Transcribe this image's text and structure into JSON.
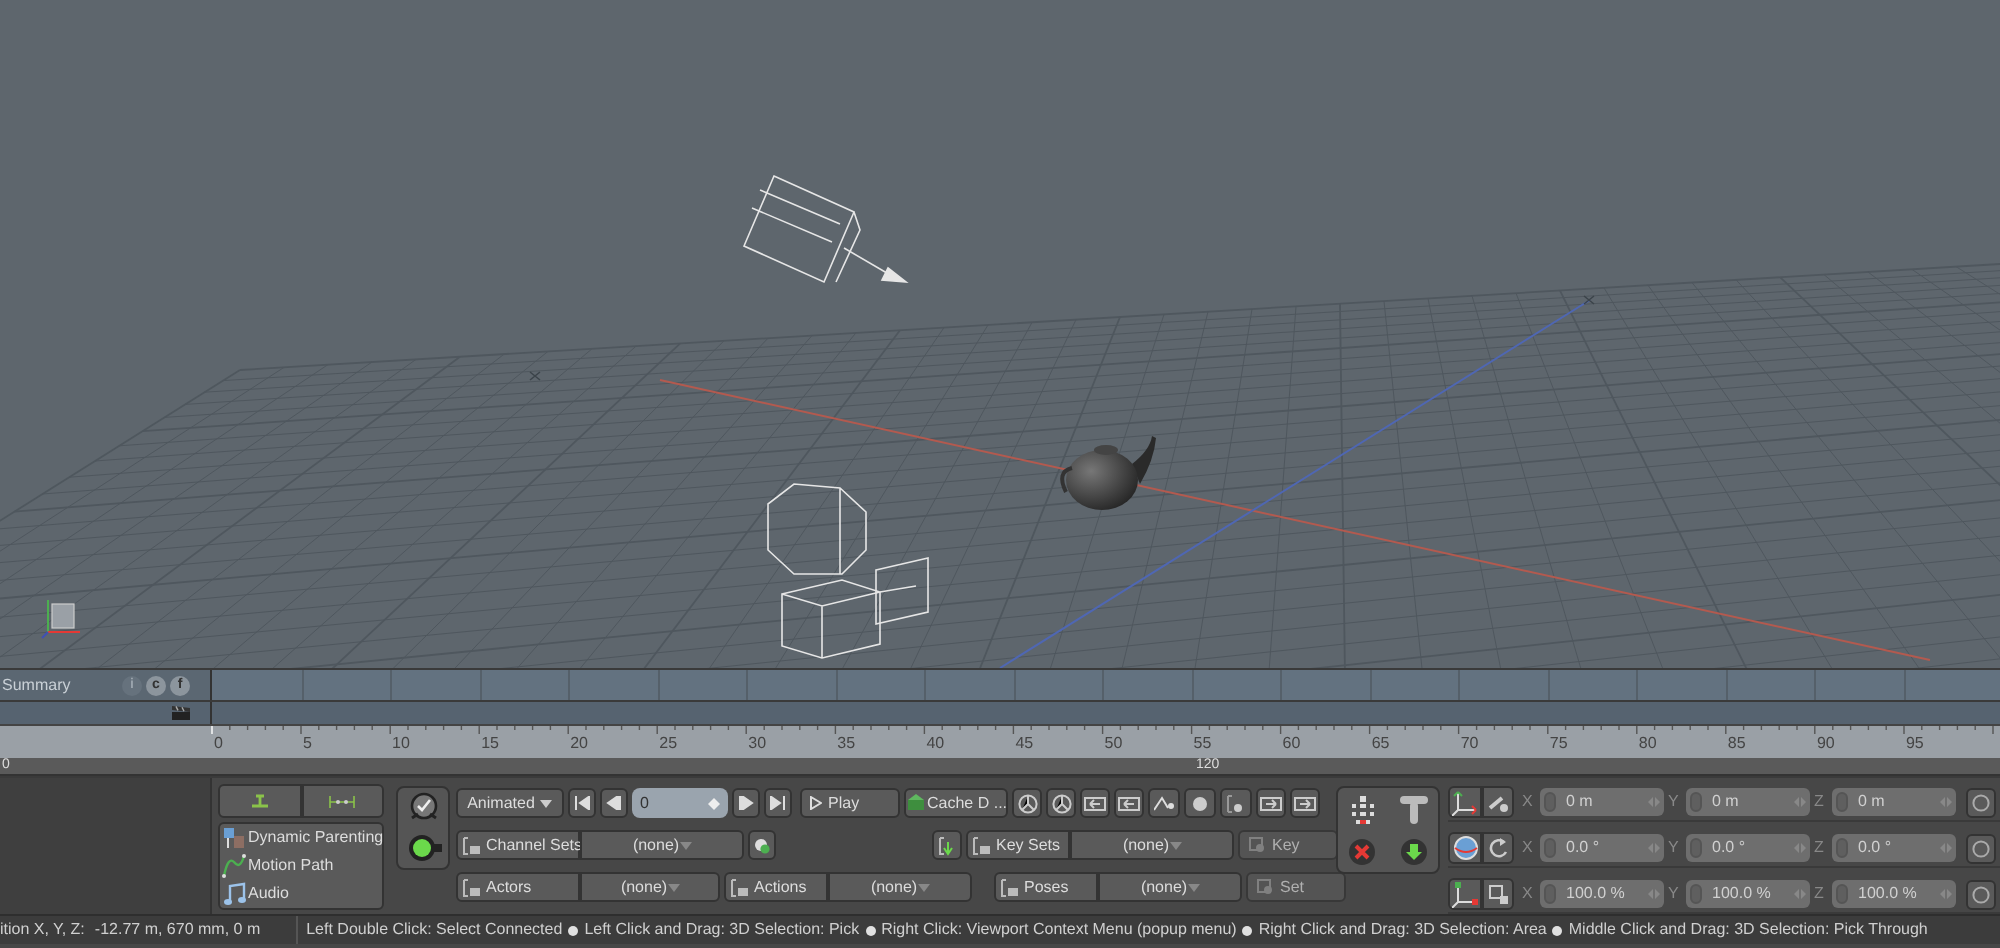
{
  "timeline": {
    "summary_label": "Summary",
    "summary_buttons": [
      "i",
      "c",
      "f"
    ],
    "ruler_labels": [
      "0",
      "5",
      "10",
      "15",
      "20",
      "25",
      "30",
      "35",
      "40",
      "45",
      "50",
      "55",
      "60",
      "65",
      "70",
      "75",
      "80",
      "85",
      "90",
      "95"
    ],
    "range_start": "0",
    "range_end": "120"
  },
  "left_panel": {
    "items": [
      {
        "kind": "parenting",
        "label": "Dynamic Parenting"
      },
      {
        "kind": "path",
        "label": "Motion Path"
      },
      {
        "kind": "audio",
        "label": "Audio"
      }
    ]
  },
  "animation": {
    "mode": "Animated",
    "frame": "0",
    "play": "Play",
    "cache": "Cache D ...",
    "channel_sets": {
      "label": "Channel Sets",
      "value": "(none)"
    },
    "key_sets": {
      "label": "Key Sets",
      "value": "(none)"
    },
    "key": {
      "label": "Key",
      "disabled": true
    },
    "actors": {
      "label": "Actors",
      "value": "(none)"
    },
    "actions": {
      "label": "Actions",
      "value": "(none)"
    },
    "poses": {
      "label": "Poses",
      "value": "(none)"
    },
    "set": {
      "label": "Set",
      "disabled": true
    }
  },
  "transform": {
    "rows": [
      {
        "kind": "position",
        "fields": [
          {
            "axis": "X",
            "value": "0 m"
          },
          {
            "axis": "Y",
            "value": "0 m"
          },
          {
            "axis": "Z",
            "value": "0 m"
          }
        ]
      },
      {
        "kind": "rotation",
        "fields": [
          {
            "axis": "X",
            "value": "0.0 °"
          },
          {
            "axis": "Y",
            "value": "0.0 °"
          },
          {
            "axis": "Z",
            "value": "0.0 °"
          }
        ]
      },
      {
        "kind": "scale",
        "fields": [
          {
            "axis": "X",
            "value": "100.0 %"
          },
          {
            "axis": "Y",
            "value": "100.0 %"
          },
          {
            "axis": "Z",
            "value": "100.0 %"
          }
        ]
      }
    ]
  },
  "status_bar": {
    "position_label": "ition X, Y, Z:",
    "position_value": "-12.77 m, 670 mm, 0 m",
    "hints": [
      "Left Double Click: Select Connected",
      "Left Click and Drag: 3D Selection: Pick",
      "Right Click: Viewport Context Menu (popup menu)",
      "Right Click and Drag: 3D Selection: Area",
      "Middle Click and Drag: 3D Selection: Pick Through"
    ]
  }
}
